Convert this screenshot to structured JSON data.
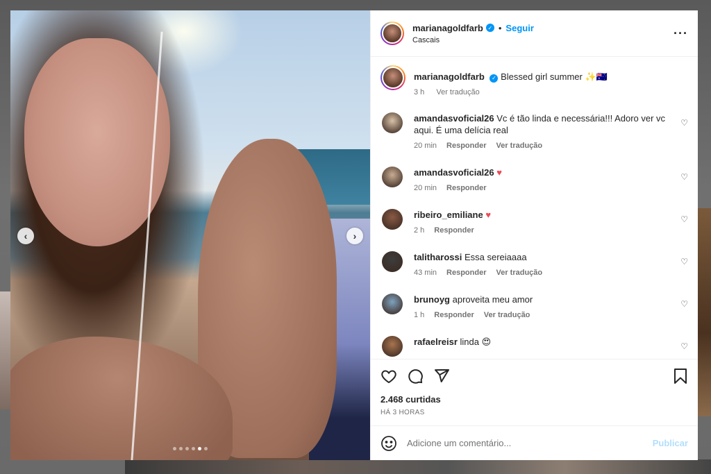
{
  "post": {
    "username": "marianagoldfarb",
    "follow_label": "Seguir",
    "separator": "•",
    "location": "Cascais",
    "more_icon": "more-horizontal-icon",
    "caption_text": "Blessed girl summer ✨🇦🇺",
    "caption_time": "3 h",
    "caption_translate": "Ver tradução",
    "carousel": {
      "slides": 6,
      "active_index": 4
    }
  },
  "comments": [
    {
      "user": "amandasvoficial26",
      "text": "Vc é tão linda e necessária!!! Adoro ver vc aqui. É uma delícia real",
      "time": "20 min",
      "reply": "Responder",
      "translate": "Ver tradução",
      "avatar_color": "#d9c2a8"
    },
    {
      "user": "amandasvoficial26",
      "text": "",
      "heart": "♥",
      "time": "20 min",
      "reply": "Responder",
      "translate": "",
      "avatar_color": "#c9ad93"
    },
    {
      "user": "ribeiro_emiliane",
      "text": "",
      "heart": "♥",
      "time": "2 h",
      "reply": "Responder",
      "translate": "",
      "avatar_color": "#8a5a44"
    },
    {
      "user": "talitharossi",
      "text": "Essa sereiaaaa",
      "time": "43 min",
      "reply": "Responder",
      "translate": "Ver tradução",
      "avatar_color": "#3d3d3d"
    },
    {
      "user": "brunoyg",
      "text": "aproveita meu amor",
      "time": "1 h",
      "reply": "Responder",
      "translate": "Ver tradução",
      "avatar_color": "#7fa2bf"
    },
    {
      "user": "rafaelreisr",
      "text": "linda 😍",
      "time": "",
      "reply": "",
      "translate": "",
      "avatar_color": "#a8744e"
    }
  ],
  "actions": {
    "likes": "2.468 curtidas",
    "time_ago": "HÁ 3 HORAS"
  },
  "add_comment": {
    "placeholder": "Adicione um comentário...",
    "publish_label": "Publicar"
  },
  "colors": {
    "accent": "#0095f6",
    "heart_red": "#ed4956",
    "publish_disabled": "#b2dffc"
  }
}
